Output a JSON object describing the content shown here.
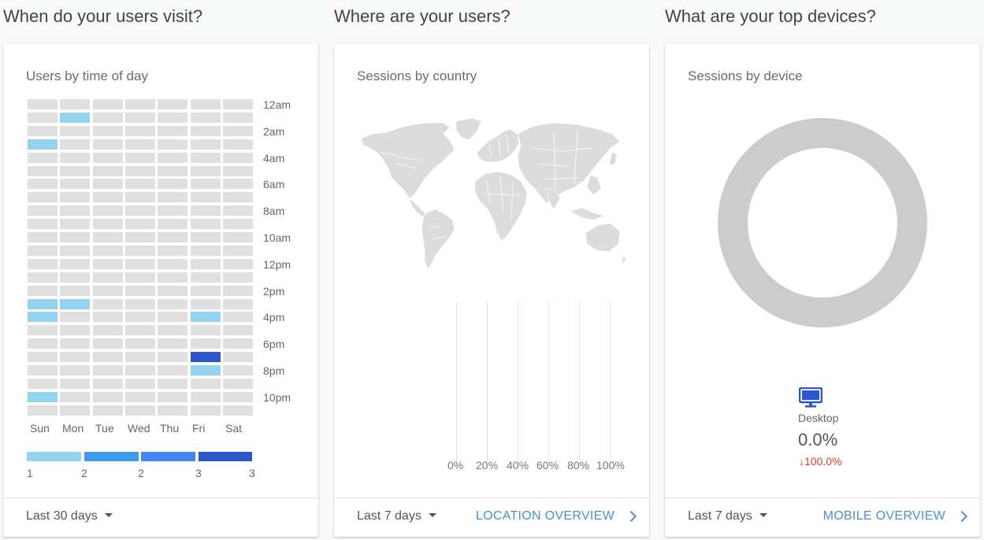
{
  "sections": {
    "visit_title": "When do your users visit?",
    "location_title": "Where are your users?",
    "devices_title": "What are your top devices?"
  },
  "time_card": {
    "title": "Users by time of day",
    "hours": [
      "12am",
      "2am",
      "4am",
      "6am",
      "8am",
      "10am",
      "12pm",
      "2pm",
      "4pm",
      "6pm",
      "8pm",
      "10pm"
    ],
    "days": [
      "Sun",
      "Mon",
      "Tue",
      "Wed",
      "Thu",
      "Fri",
      "Sat"
    ],
    "legend": [
      "1",
      "2",
      "2",
      "3",
      "3"
    ],
    "date_range": "Last 30 days",
    "colors": {
      "empty": "#e0e0e0",
      "l1": "#93d3ef",
      "l2": "#3d9ae8",
      "l3": "#4285f4",
      "l4": "#2a56c6"
    },
    "highlights": [
      {
        "day": 1,
        "hour": 1,
        "level": 1
      },
      {
        "day": 0,
        "hour": 3,
        "level": 1
      },
      {
        "day": 0,
        "hour": 15,
        "level": 1
      },
      {
        "day": 1,
        "hour": 15,
        "level": 1
      },
      {
        "day": 0,
        "hour": 16,
        "level": 1
      },
      {
        "day": 5,
        "hour": 16,
        "level": 1
      },
      {
        "day": 5,
        "hour": 19,
        "level": 4
      },
      {
        "day": 5,
        "hour": 20,
        "level": 1
      },
      {
        "day": 0,
        "hour": 22,
        "level": 1
      }
    ]
  },
  "country_card": {
    "title": "Sessions by country",
    "axis": [
      "0%",
      "20%",
      "40%",
      "60%",
      "80%",
      "100%"
    ],
    "date_range": "Last 7 days",
    "link": "LOCATION OVERVIEW"
  },
  "device_card": {
    "title": "Sessions by device",
    "device": "Desktop",
    "value": "0.0%",
    "change": "100.0%",
    "date_range": "Last 7 days",
    "link": "MOBILE OVERVIEW",
    "icon": "desktop-icon"
  }
}
